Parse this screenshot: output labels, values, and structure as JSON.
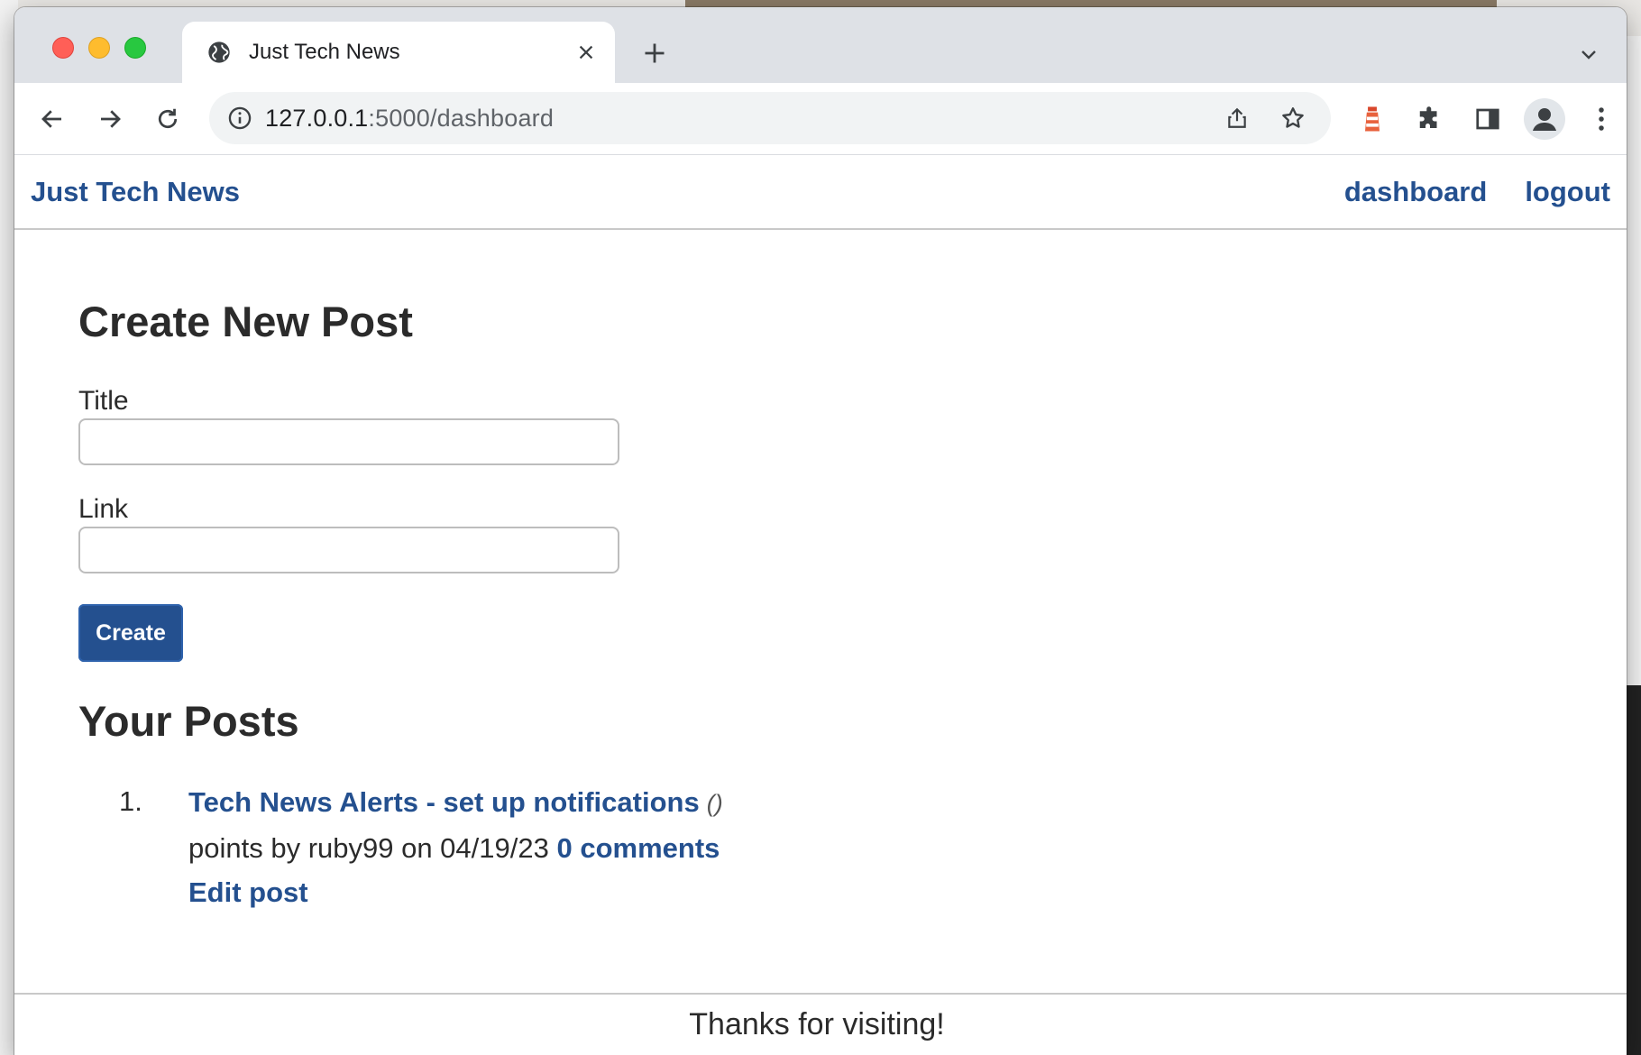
{
  "browser": {
    "tab_title": "Just Tech News",
    "url_host": "127.0.0.1",
    "url_rest": ":5000/dashboard",
    "icons": [
      "globe-icon",
      "close-icon",
      "plus-icon",
      "chevron-down-icon",
      "back-arrow-icon",
      "forward-arrow-icon",
      "reload-icon",
      "info-icon",
      "share-icon",
      "star-icon",
      "lighthouse-icon",
      "puzzle-icon",
      "side-panel-icon",
      "profile-icon",
      "kebab-menu-icon"
    ]
  },
  "site": {
    "brand": "Just Tech News",
    "nav": {
      "dashboard": "dashboard",
      "logout": "logout"
    }
  },
  "create_form": {
    "heading": "Create New Post",
    "title_label": "Title",
    "title_value": "",
    "link_label": "Link",
    "link_value": "",
    "submit_label": "Create"
  },
  "posts": {
    "heading": "Your Posts",
    "items": [
      {
        "number": "1.",
        "title": "Tech News Alerts - set up notifications",
        "domain": "()",
        "meta": "points by ruby99 on 04/19/23",
        "comments": "0 comments",
        "edit": "Edit post"
      }
    ]
  },
  "footer": {
    "text": "Thanks for visiting!"
  },
  "colors": {
    "link": "#24508f",
    "button": "#24508f",
    "text": "#2b2b2b"
  }
}
